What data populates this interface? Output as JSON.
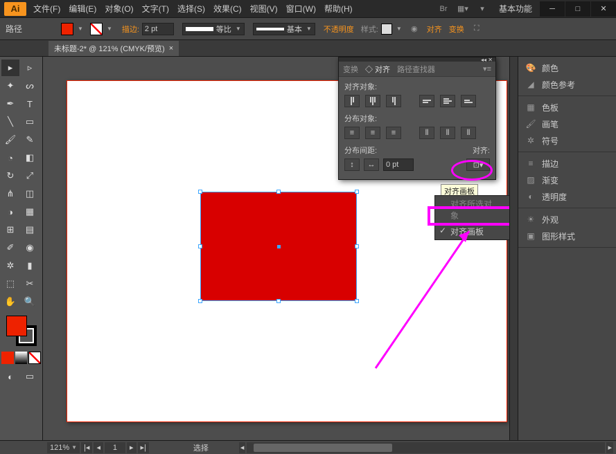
{
  "app_badge": "Ai",
  "menu": [
    "文件(F)",
    "编辑(E)",
    "对象(O)",
    "文字(T)",
    "选择(S)",
    "效果(C)",
    "视图(V)",
    "窗口(W)",
    "帮助(H)"
  ],
  "workspace_label": "基本功能",
  "controlbar": {
    "tool_label": "路径",
    "stroke_label": "描边:",
    "stroke_weight": "2 pt",
    "dash_label": "等比",
    "profile_label": "基本",
    "opacity_label": "不透明度",
    "style_label": "样式:",
    "align_label": "对齐",
    "transform_label": "变换"
  },
  "doc_tab": {
    "title": "未标题-2* @ 121% (CMYK/预览)",
    "close": "×"
  },
  "align_panel": {
    "tabs": [
      "变换",
      "◇ 对齐",
      "路径查找器"
    ],
    "section1": "对齐对象:",
    "section2": "分布对象:",
    "section3": "分布间距:",
    "section3r": "对齐:",
    "spacing_value": "0 pt"
  },
  "tooltip_align_artboard": "对齐画板",
  "dd_partial": "对齐所选对象",
  "dd_sel": "对齐画板",
  "dock": {
    "g1": [
      "颜色",
      "颜色参考"
    ],
    "g2": [
      "色板",
      "画笔",
      "符号"
    ],
    "g3": [
      "描边",
      "渐变",
      "透明度"
    ],
    "g4": [
      "外观",
      "图形样式"
    ]
  },
  "status": {
    "zoom": "121%",
    "page": "1",
    "mode": "选择"
  },
  "colors": {
    "accent": "#f7941e",
    "fill": "#d80000",
    "magenta": "#ff00ff"
  }
}
